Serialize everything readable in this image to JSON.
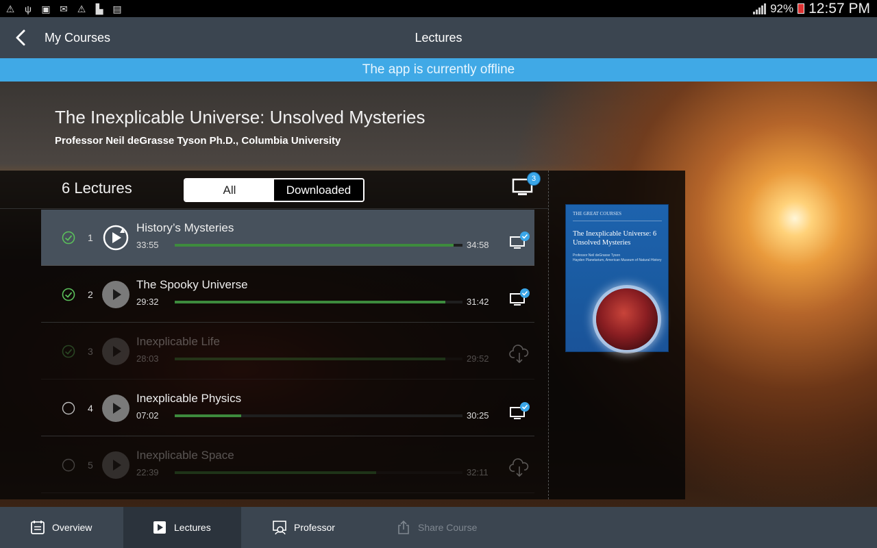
{
  "status_bar": {
    "battery": "92%",
    "time": "12:57 PM"
  },
  "app_bar": {
    "back_label": "My Courses",
    "title": "Lectures"
  },
  "offline_banner": "The app is currently offline",
  "course": {
    "title": "The Inexplicable Universe: Unsolved Mysteries",
    "professor": "Professor Neil deGrasse Tyson Ph.D., Columbia University"
  },
  "lectures_header": {
    "count_label": "6 Lectures",
    "filter_all": "All",
    "filter_downloaded": "Downloaded",
    "download_queue_count": "3"
  },
  "lectures": [
    {
      "number": "1",
      "title": "History’s Mysteries",
      "elapsed": "33:55",
      "total": "34:58",
      "progress": 0.97,
      "watched": true,
      "downloaded": true,
      "selected": true,
      "dimmed": false,
      "icon": "replay-icon"
    },
    {
      "number": "2",
      "title": "The Spooky Universe",
      "elapsed": "29:32",
      "total": "31:42",
      "progress": 0.94,
      "watched": true,
      "downloaded": true,
      "selected": false,
      "dimmed": false,
      "icon": "play-icon"
    },
    {
      "number": "3",
      "title": "Inexplicable Life",
      "elapsed": "28:03",
      "total": "29:52",
      "progress": 0.94,
      "watched": true,
      "downloaded": false,
      "selected": false,
      "dimmed": true,
      "icon": "play-icon"
    },
    {
      "number": "4",
      "title": "Inexplicable Physics",
      "elapsed": "07:02",
      "total": "30:25",
      "progress": 0.23,
      "watched": false,
      "downloaded": true,
      "selected": false,
      "dimmed": false,
      "icon": "play-icon"
    },
    {
      "number": "5",
      "title": "Inexplicable Space",
      "elapsed": "22:39",
      "total": "32:11",
      "progress": 0.7,
      "watched": false,
      "downloaded": false,
      "selected": false,
      "dimmed": true,
      "icon": "play-icon"
    }
  ],
  "cover": {
    "brand": "THE GREAT COURSES",
    "title": "The Inexplicable Universe: 6 Unsolved Mysteries",
    "author": "Professor Neil deGrasse Tyson",
    "author_affiliation": "Hayden Planetarium, American Museum of Natural History"
  },
  "bottom_nav": {
    "overview": "Overview",
    "lectures": "Lectures",
    "professor": "Professor",
    "share": "Share Course"
  },
  "colors": {
    "app_bar": "#3b4550",
    "offline_banner": "#40a9e6",
    "progress": "#3d8b3d",
    "check": "#5bc05b",
    "download_badge": "#3aa6e8"
  }
}
